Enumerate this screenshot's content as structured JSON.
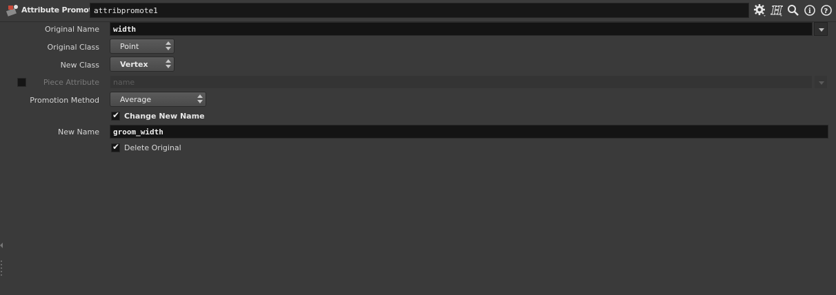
{
  "header": {
    "node_type": "Attribute Promote",
    "node_name": "attribpromote1",
    "icons": [
      "attribute-promote-node-icon",
      "gear-icon",
      "help-h-icon",
      "search-icon",
      "info-icon",
      "question-icon"
    ]
  },
  "params": {
    "original_name": {
      "label": "Original Name",
      "value": "width"
    },
    "original_class": {
      "label": "Original Class",
      "value": "Point"
    },
    "new_class": {
      "label": "New Class",
      "value": "Vertex"
    },
    "piece_attribute": {
      "label": "Piece Attribute",
      "placeholder": "name",
      "enabled": false
    },
    "promotion_method": {
      "label": "Promotion Method",
      "value": "Average"
    },
    "change_new_name": {
      "label": "Change New Name",
      "checked": true
    },
    "new_name": {
      "label": "New Name",
      "value": "groom_width"
    },
    "delete_original": {
      "label": "Delete Original",
      "checked": true
    }
  },
  "colors": {
    "background": "#3a3a3a",
    "field": "#141414",
    "menu": "#4f4f4f",
    "text": "#d4d4d4"
  }
}
